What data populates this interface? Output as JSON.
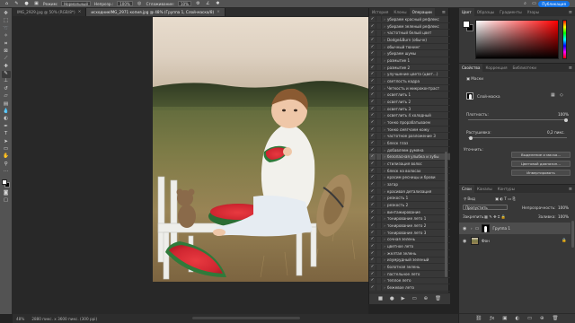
{
  "options_bar": {
    "mode_label": "Режим:",
    "mode_value": "Нормальный",
    "opacity_label": "Непрозр.:",
    "opacity_value": "100%",
    "smoothing_label": "Сглаживание:",
    "smoothing_value": "10%",
    "publish_label": "Публикация"
  },
  "tabs": [
    {
      "label": "IMG_2929.jpg @ 50% (RGB/8*)",
      "close": "×"
    },
    {
      "label": "исходникIMG_2971 копия.jpg @ 48% (Группа 1, Слой-маска/8)",
      "close": "×"
    }
  ],
  "status": {
    "zoom": "48%",
    "doc_info": "2880 пикс. x 3600 пикс. (300 ppi)"
  },
  "actions_panel": {
    "tabs": [
      "История",
      "Клоны",
      "Операции"
    ],
    "selected_index": 20,
    "items": [
      "убираем красный рефлекс",
      "убираем зеленый рефлекс",
      "частотный белый цвет",
      "Dodge&Burn (обычн)",
      "обычный тюнинг",
      "убираем шумы",
      "размытие 1",
      "размытие 2",
      "улучшение цвета (цвет...)",
      "светлость кадра",
      "Четкость и микроконтраст",
      "осветлить 1",
      "осветлить 2",
      "осветлить 3",
      "осветлить 4 холодный",
      "тонко прорабатываем",
      "тонко смягчаем кожу",
      "частотное разложение 3",
      "блеск глаз",
      "добавляем румяна",
      "безопасная улыбка и зубы",
      "стилизация волос",
      "блеск на волосах",
      "красим ресницы и брови",
      "загар",
      "красивая детализация",
      "резкость 1",
      "резкость 2",
      "винтажирование",
      "тонирование лето 1",
      "тонирование лето 2",
      "тонирование лето 3",
      "сочная зелень",
      "цветное лето",
      "желтая зелень",
      "изумрудный зеленый",
      "болотная зелень",
      "пастельное лето",
      "теплое лето",
      "бежевое лето"
    ]
  },
  "color_panel": {
    "tabs": [
      "Цвет",
      "Образцы",
      "Градиенты",
      "Узоры"
    ]
  },
  "properties_panel": {
    "tabs": [
      "Свойства",
      "Коррекция",
      "Библиотеки"
    ],
    "masks_label": "Маски",
    "layer_mask_label": "Слой-маска",
    "density_label": "Плотность:",
    "density_value": "100%",
    "feather_label": "Растушевка:",
    "feather_value": "0,2 пикс.",
    "refine_label": "Уточнить:",
    "select_mask_button": "Выделение и маска...",
    "color_range_button": "Цветовой диапазон...",
    "invert_button": "Инвертировать"
  },
  "layers_panel": {
    "tabs": [
      "Слои",
      "Каналы",
      "Контуры"
    ],
    "kind_filter": "Вид",
    "blend_mode": "Пропустить",
    "opacity_label": "Непрозрачность:",
    "opacity_value": "100%",
    "lock_label": "Закрепить:",
    "fill_label": "Заливка:",
    "fill_value": "100%",
    "layers": [
      {
        "name": "Группа 1",
        "selected": true
      },
      {
        "name": "Фон",
        "selected": false
      }
    ]
  }
}
